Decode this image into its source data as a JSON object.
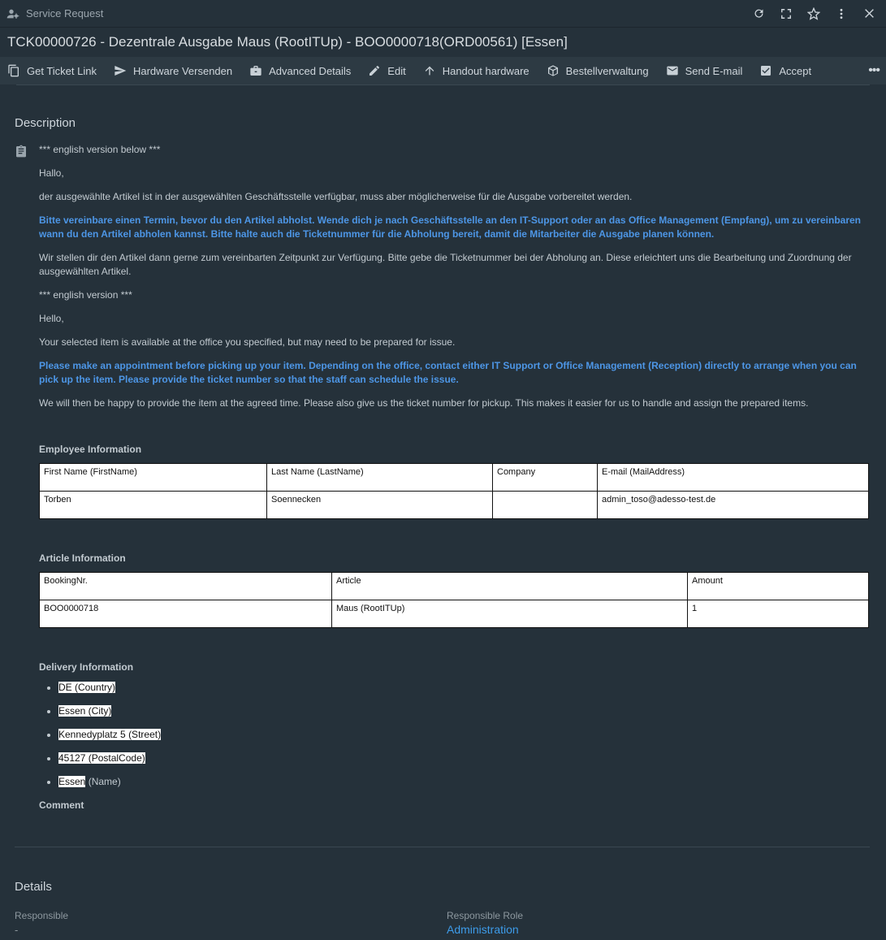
{
  "window": {
    "app_title": "Service Request",
    "ticket_title": "TCK00000726 - Dezentrale Ausgabe Maus (RootITUp) - BOO0000718(ORD00561) [Essen]"
  },
  "toolbar": {
    "get_ticket_link": "Get Ticket Link",
    "hardware_versenden": "Hardware Versenden",
    "advanced_details": "Advanced Details",
    "edit": "Edit",
    "handout_hardware": "Handout hardware",
    "bestellverwaltung": "Bestellverwaltung",
    "send_email": "Send E-mail",
    "accept": "Accept",
    "more": "•••"
  },
  "description": {
    "title": "Description",
    "p1": "*** english version below ***",
    "p2": "Hallo,",
    "p3": "der ausgewählte Artikel ist in der ausgewählten Geschäftsstelle verfügbar, muss aber möglicherweise für die Ausgabe vorbereitet werden.",
    "p4": "Bitte vereinbare einen Termin, bevor du den Artikel abholst. Wende dich je nach Geschäftsstelle an den IT-Support oder an das Office Management (Empfang), um zu vereinbaren wann du den Artikel abholen kannst. Bitte halte auch die Ticketnummer für die Abholung bereit, damit die Mitarbeiter die Ausgabe planen können.",
    "p5": "Wir stellen dir den Artikel dann gerne zum vereinbarten Zeitpunkt zur Verfügung. Bitte gebe die Ticketnummer bei der Abholung an. Diese erleichtert uns die Bearbeitung und Zuordnung der ausgewählten Artikel.",
    "p6": "*** english version ***",
    "p7": "Hello,",
    "p8": "Your selected item is available at the office you specified, but may need to be prepared for issue.",
    "p9": "Please make an appointment before picking up your item. Depending on the office, contact either IT Support or Office Management (Reception) directly to arrange when you can pick up the item. Please provide the ticket number so that the staff can schedule the issue.",
    "p10": "We will then be happy to provide the item at the agreed time. Please also give us the ticket number for pickup. This makes it easier for us to handle and assign the prepared items."
  },
  "employee": {
    "heading": "Employee Information",
    "headers": [
      "First Name (FirstName)",
      "Last Name (LastName)",
      "Company",
      "E-mail (MailAddress)"
    ],
    "row": [
      "Torben",
      "Soennecken",
      "",
      "admin_toso@adesso-test.de"
    ]
  },
  "article": {
    "heading": "Article Information",
    "headers": [
      "BookingNr.",
      "Article",
      "Amount"
    ],
    "row": [
      "BOO0000718",
      "Maus (RootITUp)",
      "1"
    ]
  },
  "delivery": {
    "heading": "Delivery Information",
    "country": "DE (Country)",
    "city": "Essen (City)",
    "street": "Kennedyplatz 5 (Street)",
    "postal": "45127 (PostalCode)",
    "name_value": "Essen",
    "name_suffix": " (Name)",
    "comment_label": "Comment"
  },
  "details": {
    "title": "Details",
    "responsible_label": "Responsible",
    "responsible_value": "-",
    "role_label": "Responsible Role",
    "role_value": "Administration"
  }
}
